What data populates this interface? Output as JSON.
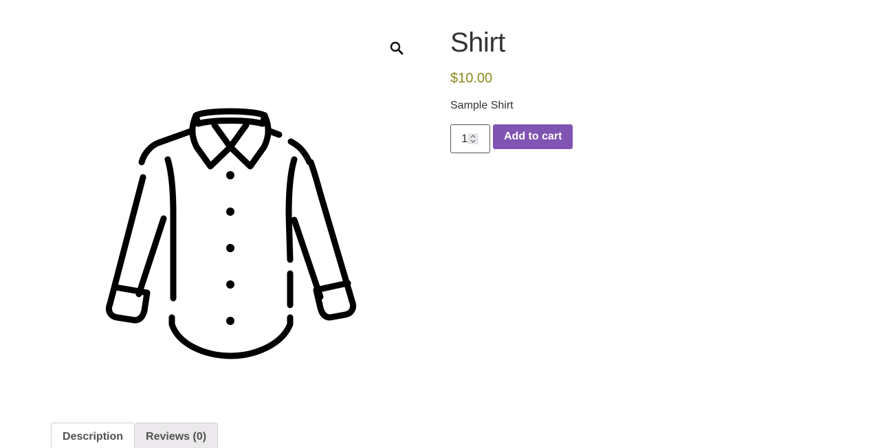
{
  "product": {
    "title": "Shirt",
    "price": "$10.00",
    "short_description": "Sample Shirt",
    "quantity": "1",
    "add_to_cart_label": "Add to cart",
    "accent_color": "#7f54b3",
    "price_color": "#8a8a1e"
  },
  "gallery": {
    "zoom_icon": "magnifier-icon",
    "image_subject": "shirt-line-icon"
  },
  "tabs": [
    {
      "label": "Description",
      "active": true
    },
    {
      "label": "Reviews (0)",
      "active": false
    }
  ]
}
